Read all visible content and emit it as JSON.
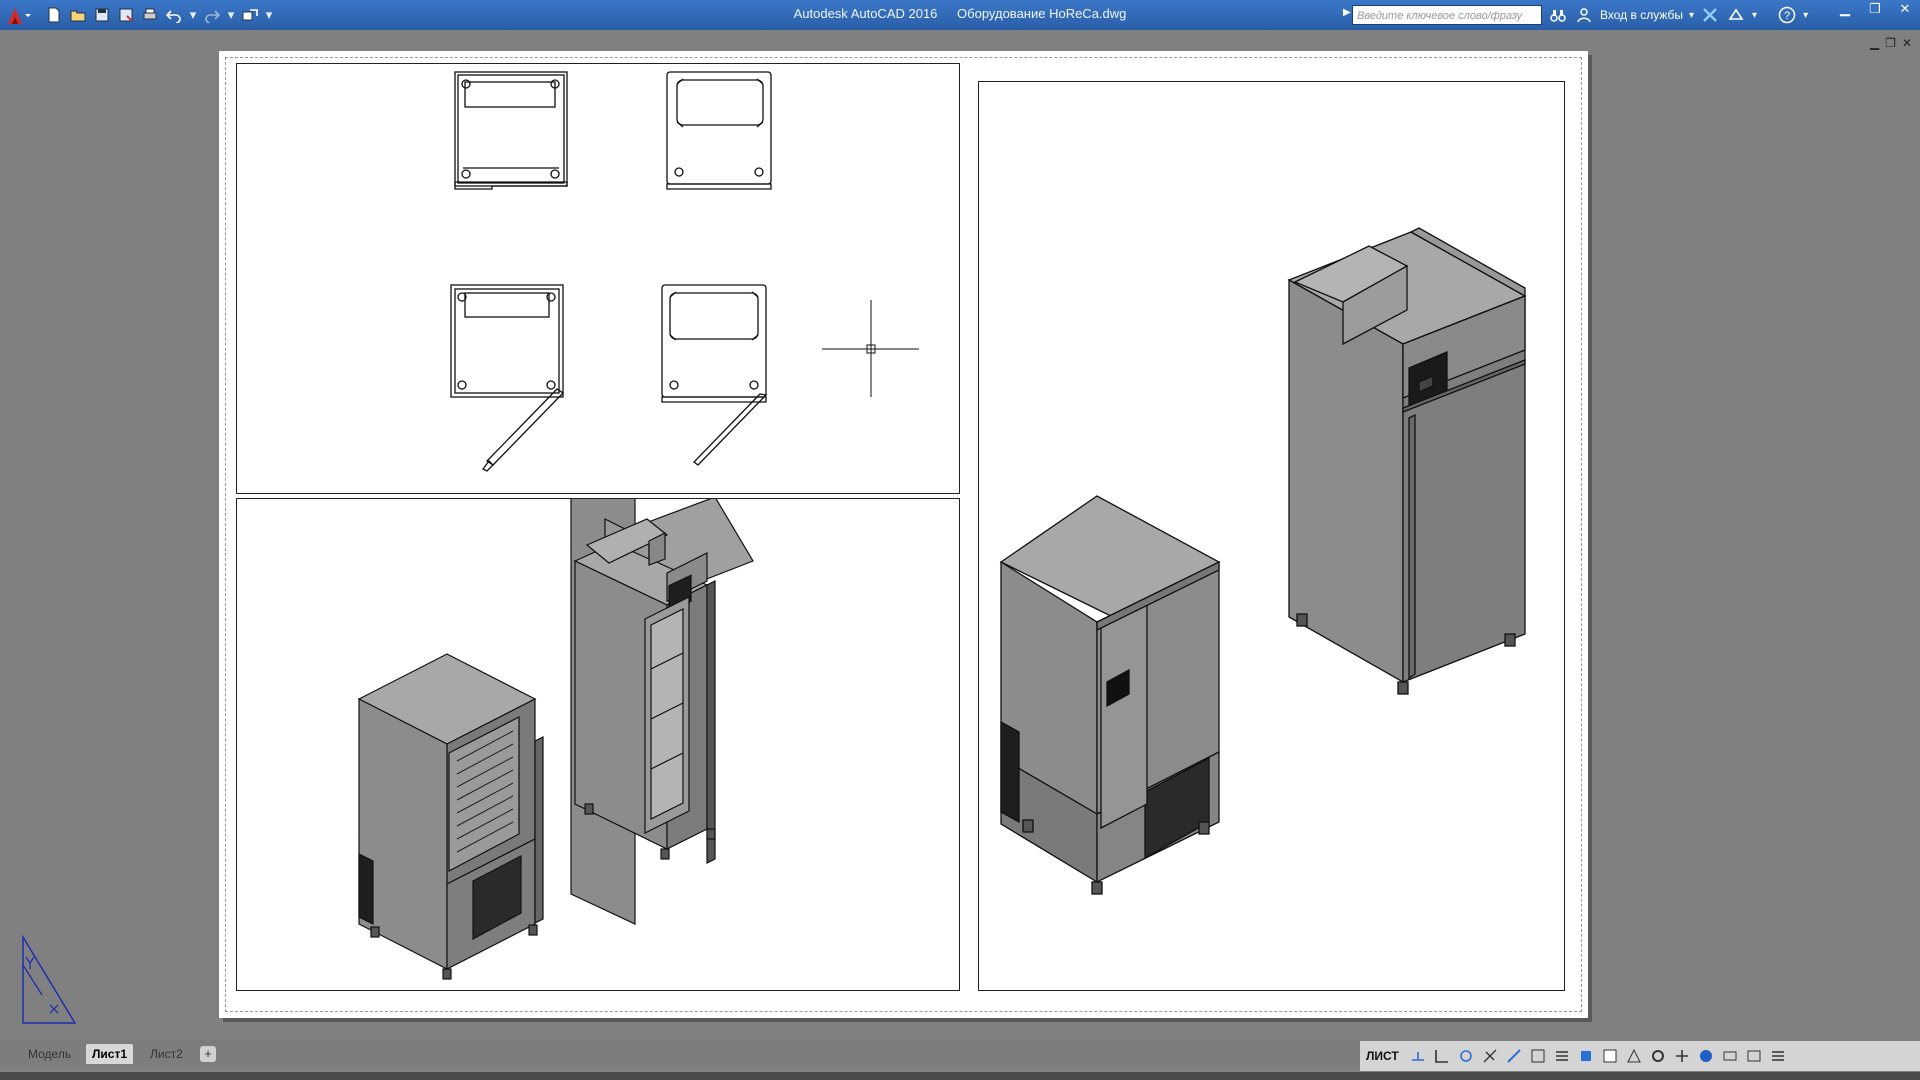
{
  "app": {
    "name": "Autodesk AutoCAD 2016",
    "document": "Оборудование HoReCa.dwg"
  },
  "search": {
    "placeholder": "Введите ключевое слово/фразу"
  },
  "signin": {
    "label": "Вход в службы"
  },
  "tabs": [
    {
      "label": "Модель",
      "active": false
    },
    {
      "label": "Лист1",
      "active": true
    },
    {
      "label": "Лист2",
      "active": false
    }
  ],
  "status": {
    "mode": "ЛИСТ"
  },
  "colors": {
    "titlebar": "#2f69b6",
    "canvas": "#808080",
    "paper": "#ffffff",
    "equipment_face": "#8c8c8c",
    "equipment_dark": "#6e6e6e",
    "equipment_light": "#a8a8a8"
  },
  "icons": [
    "autocad-logo-icon",
    "new-icon",
    "open-icon",
    "save-icon",
    "save-as-icon",
    "print-icon",
    "undo-icon",
    "redo-icon",
    "share-icon",
    "binoculars-icon",
    "user-icon",
    "exchange-icon",
    "autodesk360-icon",
    "help-icon"
  ]
}
